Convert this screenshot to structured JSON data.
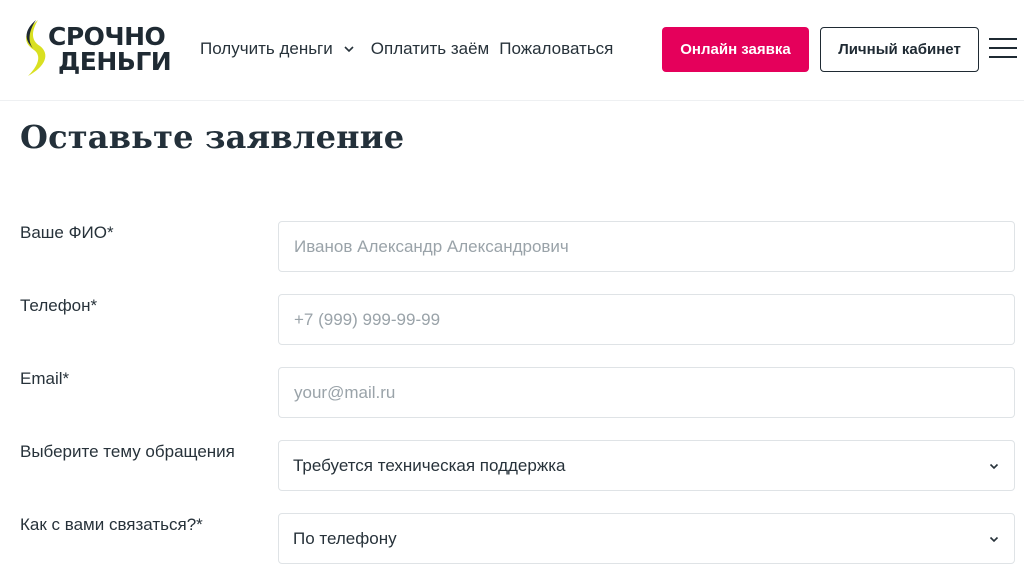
{
  "header": {
    "logo": {
      "line1": "СРОЧНО",
      "line2": "ДЕНЬГИ"
    },
    "nav": [
      {
        "label": "Получить деньги",
        "has_dropdown": true
      },
      {
        "label": "Оплатить заём"
      },
      {
        "label": "Пожаловаться"
      }
    ],
    "apply_button": "Онлайн заявка",
    "cabinet_button": "Личный кабинет"
  },
  "page": {
    "title": "Оставьте заявление"
  },
  "form": {
    "name": {
      "label": "Ваше ФИО*",
      "placeholder": "Иванов Александр Александрович"
    },
    "phone": {
      "label": "Телефон*",
      "placeholder": "+7 (999) 999-99-99"
    },
    "email": {
      "label": "Email*",
      "placeholder": "your@mail.ru"
    },
    "topic": {
      "label": "Выберите тему обращения",
      "value": "Требуется техническая поддержка"
    },
    "contact": {
      "label": "Как с вами связаться?*",
      "value": "По телефону"
    }
  },
  "colors": {
    "accent": "#e5005b",
    "text": "#1f2a33",
    "logo_yellow": "#d9e021"
  }
}
